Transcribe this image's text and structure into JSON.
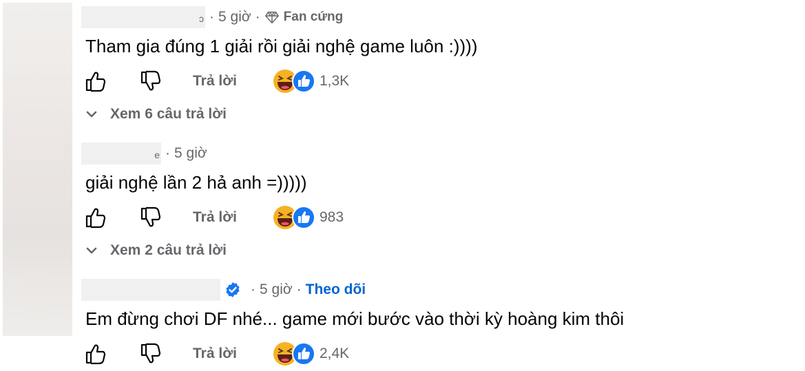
{
  "comments": [
    {
      "time": "5 giờ",
      "badge": "Fan cứng",
      "text": "Tham gia đúng 1 giải rồi giải nghệ game luôn :))))",
      "reply_label": "Trả lời",
      "reaction_count": "1,3K",
      "view_replies": "Xem 6 câu trả lời"
    },
    {
      "time": "5 giờ",
      "text": "giải nghệ lần 2 hả anh =)))))",
      "reply_label": "Trả lời",
      "reaction_count": "983",
      "view_replies": "Xem 2 câu trả lời"
    },
    {
      "time": "5 giờ",
      "follow_label": "Theo dõi",
      "text": "Em đừng chơi DF nhé... game mới bước vào thời kỳ hoàng kim thôi",
      "reply_label": "Trả lời",
      "reaction_count": "2,4K"
    }
  ],
  "icons": {
    "like": "thumbs-up-outline-icon",
    "dislike": "thumbs-down-outline-icon",
    "haha": "haha-reaction-icon",
    "like_reaction": "like-reaction-icon",
    "badge": "diamond-icon",
    "verified": "verified-badge-icon",
    "expand": "chevron-down-icon"
  },
  "colors": {
    "secondary_text": "#65676b",
    "link_blue": "#0064d1",
    "like_blue": "#1877f2",
    "haha_yellow": "#f7b125"
  }
}
